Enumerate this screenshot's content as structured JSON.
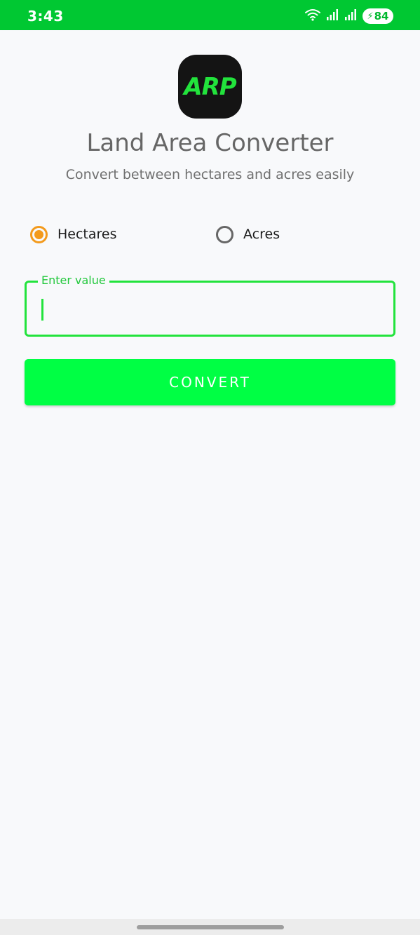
{
  "status_bar": {
    "time": "3:43",
    "battery_level": "84",
    "icons": [
      "wifi-icon",
      "signal-icon",
      "signal-icon",
      "battery-charging-icon"
    ],
    "background_color": "#00c832"
  },
  "app": {
    "logo_text": "ARP",
    "title": "Land Area Converter",
    "subtitle": "Convert between hectares and acres easily"
  },
  "unit_selector": {
    "options": [
      {
        "label": "Hectares",
        "selected": true
      },
      {
        "label": "Acres",
        "selected": false
      }
    ],
    "selected_color": "#f39a1c"
  },
  "value_input": {
    "label": "Enter value",
    "value": "",
    "accent_color": "#22e33c"
  },
  "convert_button": {
    "label": "CONVERT",
    "background_color": "#00ff44"
  }
}
